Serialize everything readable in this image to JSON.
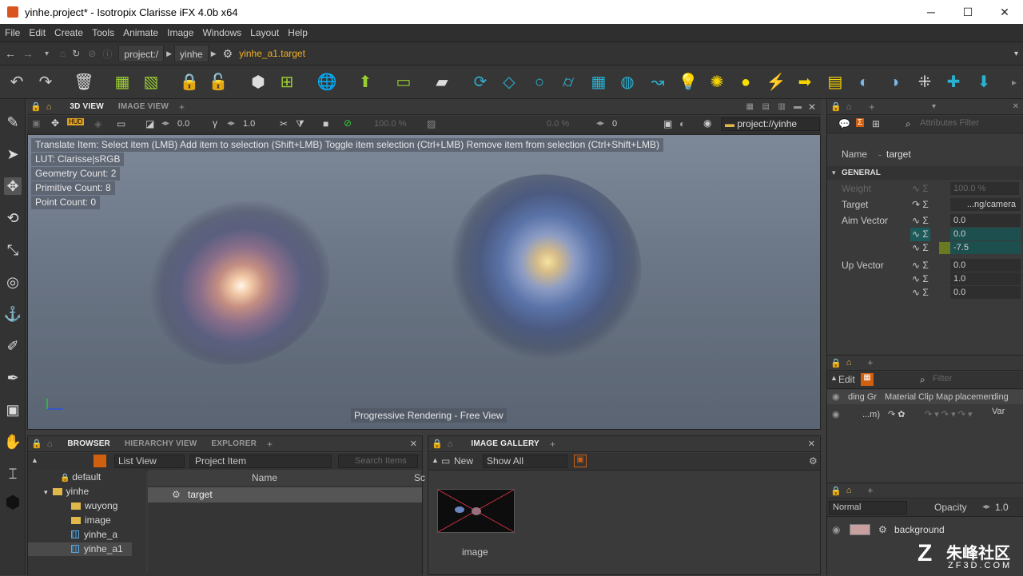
{
  "window": {
    "title": "yinhe.project* - Isotropix Clarisse iFX 4.0b x64",
    "minimize": "─",
    "maximize": "☐",
    "close": "✕"
  },
  "menu": [
    "File",
    "Edit",
    "Create",
    "Tools",
    "Animate",
    "Image",
    "Windows",
    "Layout",
    "Help"
  ],
  "path": {
    "seg1": "project:/",
    "seg2": "yinhe",
    "current": "yinhe_a1.target"
  },
  "viewport_panel": {
    "tabs": [
      "3D VIEW",
      "IMAGE VIEW"
    ],
    "add": "+",
    "field1": "0.0",
    "field2": "1.0",
    "percent1": "100.0 %",
    "percent2": "0.0 %",
    "field3": "0",
    "location": "project://yinhe",
    "hud": "HUD"
  },
  "viewport": {
    "hints": [
      "Translate Item: Select item (LMB)  Add item to selection (Shift+LMB)  Toggle item selection (Ctrl+LMB)  Remove item from selection (Ctrl+Shift+LMB)",
      "LUT: Clarisse|sRGB",
      "Geometry Count: 2",
      "Primitive Count: 8",
      "Point Count: 0"
    ],
    "status": "Progressive Rendering - Free View"
  },
  "attributes": {
    "filter_placeholder": "Attributes Filter",
    "name_label": "Name",
    "name_value": "target",
    "section": "GENERAL",
    "weight_label": "Weight",
    "weight_value": "100.0 %",
    "target_label": "Target",
    "target_value": "...ng/camera",
    "aim_label": "Aim Vector",
    "aim": [
      "0.0",
      "0.0",
      "-7.5"
    ],
    "up_label": "Up Vector",
    "up": [
      "0.0",
      "1.0",
      "0.0"
    ]
  },
  "layers_panel": {
    "edit": "Edit",
    "filter_placeholder": "Filter",
    "columns": [
      "ding Gr",
      "Material",
      "Clip Map",
      "placemen",
      "ding Var"
    ],
    "row_value": "...m)"
  },
  "composite_panel": {
    "blend": "Normal",
    "opacity_label": "Opacity",
    "opacity_value": "1.0",
    "layer_name": "background"
  },
  "browser": {
    "tabs": [
      "BROWSER",
      "HIERARCHY VIEW",
      "EXPLORER"
    ],
    "view_mode": "List View",
    "item_type": "Project Item",
    "search_placeholder": "Search Items",
    "tree": [
      {
        "label": "default"
      },
      {
        "label": "yinhe"
      },
      {
        "label": "wuyong"
      },
      {
        "label": "image"
      },
      {
        "label": "yinhe_a"
      },
      {
        "label": "yinhe_a1"
      }
    ],
    "column_name": "Name",
    "column_s": "Sc",
    "row": "target"
  },
  "gallery": {
    "tab": "IMAGE GALLERY",
    "new": "New",
    "show": "Show All",
    "thumb_label": "image"
  },
  "watermark": {
    "cn": "朱峰社区",
    "url": "ZF3D.COM"
  }
}
